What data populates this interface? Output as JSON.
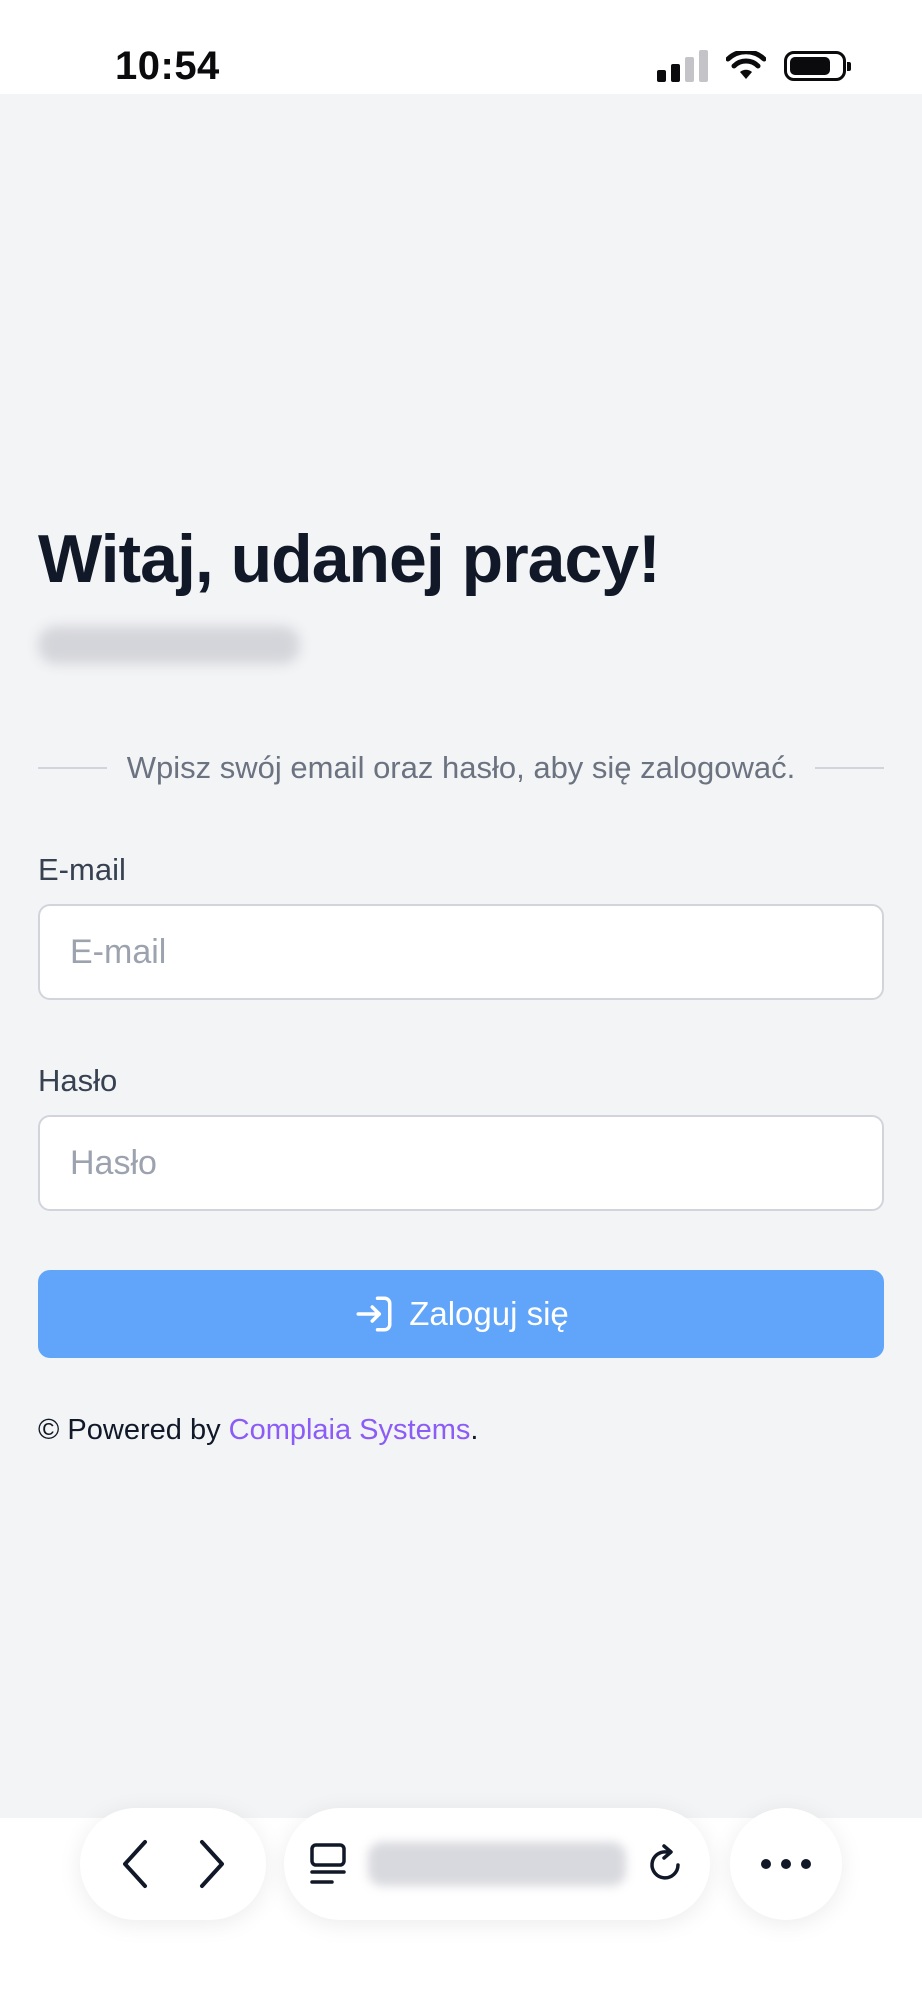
{
  "status_bar": {
    "time": "10:54"
  },
  "login": {
    "title": "Witaj, udanej pracy!",
    "instruction": "Wpisz swój email oraz hasło, aby się zalogować.",
    "email": {
      "label": "E-mail",
      "placeholder": "E-mail",
      "value": ""
    },
    "password": {
      "label": "Hasło",
      "placeholder": "Hasło",
      "value": ""
    },
    "submit_label": "Zaloguj się"
  },
  "footer": {
    "prefix": "© Powered by ",
    "link_text": "Complaia Systems",
    "suffix": "."
  },
  "colors": {
    "background": "#f3f4f6",
    "button": "#60a5fa",
    "link": "#8b5cf6",
    "title": "#111827"
  },
  "icons": [
    "signal-icon",
    "wifi-icon",
    "battery-icon",
    "login-icon",
    "back-icon",
    "forward-icon",
    "tabs-icon",
    "reload-icon",
    "more-icon"
  ]
}
